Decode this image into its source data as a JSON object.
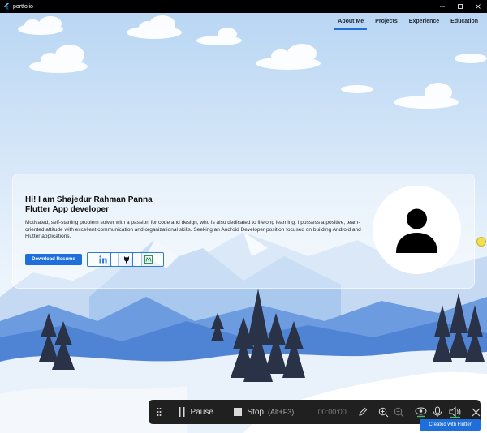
{
  "window": {
    "title": "portfolio",
    "controls": [
      "minimize",
      "maximize",
      "close"
    ]
  },
  "nav": {
    "items": [
      {
        "label": "About Me",
        "active": true
      },
      {
        "label": "Projects",
        "active": false
      },
      {
        "label": "Experience",
        "active": false
      },
      {
        "label": "Education",
        "active": false
      }
    ]
  },
  "hero": {
    "greeting": "Hi! I am Shajedur Rahman Panna",
    "role": "Flutter App developer",
    "bio": "Motivated, self-starting problem solver with a passion for code and design, who is also dedicated to lifelong learning. I possess a positive, team-oriented attitude with excellent communication and organizational skills. Seeking an Android Developer position focused on building Android and Flutter applications.",
    "download_label": "Download Resume",
    "social_icons": [
      "linkedin-icon",
      "github-icon",
      "medium-icon"
    ],
    "avatar_icon": "person-icon"
  },
  "recorder": {
    "pause_label": "Pause",
    "stop_label": "Stop",
    "stop_shortcut": "(Alt+F3)",
    "timer": "00:00:00"
  },
  "badge": {
    "label": "Created with Flutter"
  },
  "colors": {
    "accent": "#1e6fd9",
    "titlebar": "#000000",
    "toolbar": "#202020"
  }
}
